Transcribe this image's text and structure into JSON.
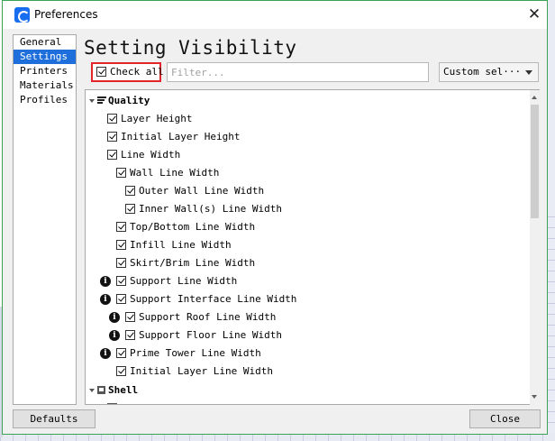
{
  "window": {
    "title": "Preferences",
    "close_glyph": "✕",
    "app_icon": "cura-logo-icon",
    "accent_color": "#1e6fdb",
    "border_color": "#3aa356",
    "highlight_color": "#e0262b"
  },
  "nav": {
    "items": [
      {
        "label": "General"
      },
      {
        "label": "Settings"
      },
      {
        "label": "Printers"
      },
      {
        "label": "Materials"
      },
      {
        "label": "Profiles"
      }
    ],
    "selected": "Settings"
  },
  "main": {
    "heading": "Setting Visibility",
    "check_all_label": "Check all",
    "check_all_checked": true,
    "filter_placeholder": "Filter...",
    "filter_value": "",
    "preset_selected": "Custom sel···"
  },
  "settings_tree": {
    "categories": [
      {
        "label": "Quality",
        "icon": "quality-bars-icon",
        "expanded": true
      },
      {
        "label": "Shell",
        "icon": "shell-icon",
        "expanded": true
      }
    ],
    "rows": [
      {
        "label": "Layer Height",
        "checked": true,
        "info": false
      },
      {
        "label": "Initial Layer Height",
        "checked": true,
        "info": false
      },
      {
        "label": "Line Width",
        "checked": true,
        "info": false
      },
      {
        "label": "Wall Line Width",
        "checked": true,
        "info": false
      },
      {
        "label": "Outer Wall Line Width",
        "checked": true,
        "info": false
      },
      {
        "label": "Inner Wall(s) Line Width",
        "checked": true,
        "info": false
      },
      {
        "label": "Top/Bottom Line Width",
        "checked": true,
        "info": false
      },
      {
        "label": "Infill Line Width",
        "checked": true,
        "info": false
      },
      {
        "label": "Skirt/Brim Line Width",
        "checked": true,
        "info": false
      },
      {
        "label": "Support Line Width",
        "checked": true,
        "info": true
      },
      {
        "label": "Support Interface Line Width",
        "checked": true,
        "info": true
      },
      {
        "label": "Support Roof Line Width",
        "checked": true,
        "info": true
      },
      {
        "label": "Support Floor Line Width",
        "checked": true,
        "info": true
      },
      {
        "label": "Prime Tower Line Width",
        "checked": true,
        "info": true
      },
      {
        "label": "Initial Layer Line Width",
        "checked": true,
        "info": false
      }
    ]
  },
  "footer": {
    "defaults_label": "Defaults",
    "close_label": "Close"
  }
}
